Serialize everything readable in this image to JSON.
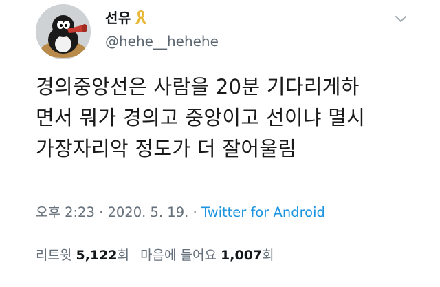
{
  "user": {
    "display_name": "선유",
    "handle": "@hehe__hehehe",
    "ribbon_color": "#e8b83a"
  },
  "tweet": {
    "text": "경의중앙선은 사람을 20분 기다리게하\n면서 뭐가 경의고 중앙이고 선이냐 멸시\n가장자리악 정도가 더 잘어울림"
  },
  "meta": {
    "time": "오후 2:23",
    "separator1": " · ",
    "date": "2020. 5. 19.",
    "separator2": " · ",
    "source": "Twitter for Android",
    "source_color": "#1b95e0"
  },
  "stats": {
    "retweets_label": "리트윗 ",
    "retweets_count": "5,122",
    "retweets_suffix": "회",
    "likes_label": "마음에 들어요 ",
    "likes_count": "1,007",
    "likes_suffix": "회"
  },
  "icons": {
    "avatar": "penguin-avatar",
    "ribbon": "yellow-ribbon-icon",
    "menu": "chevron-down-icon"
  }
}
